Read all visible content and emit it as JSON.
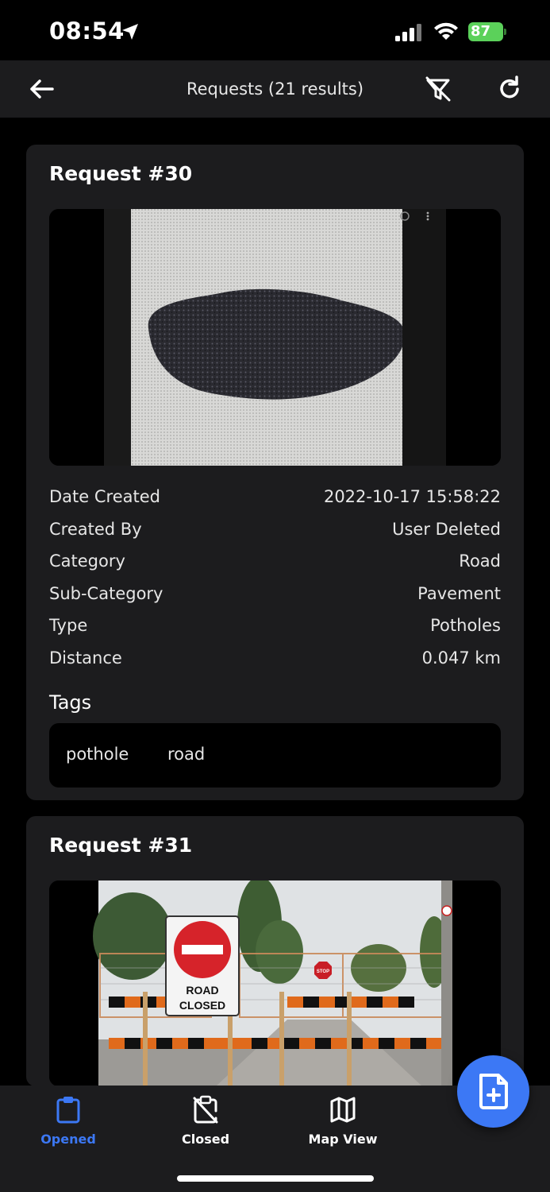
{
  "status_bar": {
    "time": "08:54",
    "battery": "87"
  },
  "header": {
    "title": "Requests (21 results)"
  },
  "requests": [
    {
      "title": "Request #30",
      "details": [
        {
          "label": "Date Created",
          "value": "2022-10-17 15:58:22"
        },
        {
          "label": "Created By",
          "value": "User Deleted"
        },
        {
          "label": "Category",
          "value": "Road"
        },
        {
          "label": "Sub-Category",
          "value": "Pavement"
        },
        {
          "label": "Type",
          "value": "Potholes"
        },
        {
          "label": "Distance",
          "value": "0.047 km"
        }
      ],
      "tags_heading": "Tags",
      "tags": [
        "pothole",
        "road"
      ]
    },
    {
      "title": "Request #31",
      "sign_text": [
        "ROAD",
        "CLOSED"
      ],
      "stop_text": "STOP"
    }
  ],
  "bottom_nav": {
    "items": [
      {
        "label": "Opened",
        "icon": "clipboard-icon"
      },
      {
        "label": "Closed",
        "icon": "clipboard-off-icon"
      },
      {
        "label": "Map View",
        "icon": "map-icon"
      }
    ]
  },
  "colors": {
    "accent": "#3c78f5",
    "background": "#000000",
    "card": "#1c1c1e",
    "battery": "#5bd15a"
  }
}
